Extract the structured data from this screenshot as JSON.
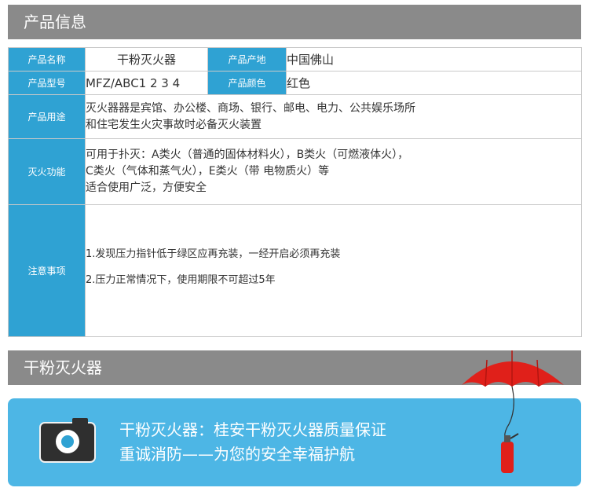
{
  "header1": {
    "title": "产品信息"
  },
  "table": {
    "row1": {
      "label1": "产品名称",
      "value1": "干粉灭火器",
      "label2": "产品产地",
      "value2": "中国佛山"
    },
    "row2": {
      "label1": "产品型号",
      "value1": "MFZ/ABC1 2 3 4",
      "label2": "产品颜色",
      "value2": "红色"
    },
    "usage": {
      "label": "产品用途",
      "lines": [
        "灭火器器是宾馆、办公楼、商场、银行、邮电、电力、公共娱乐场所",
        "和住宅发生火灾事故时必备灭火装置"
      ]
    },
    "function": {
      "label": "灭火功能",
      "lines": [
        "可用于扑灭：A类火（普通的固体材料火），B类火（可燃液体火），",
        "C类火（气体和蒸气火），E类火（带 电物质火）等",
        "适合使用广泛，方便安全"
      ]
    },
    "notes": {
      "label": "注意事项",
      "lines": [
        "1.发现压力指针低于绿区应再充装，一经开启必须再充装",
        "2.压力正常情况下，使用期限不可超过5年"
      ]
    }
  },
  "header2": {
    "title": "干粉灭火器"
  },
  "banner": {
    "line1": "干粉灭火器：桂安干粉灭火器质量保证",
    "line2": "重诚消防——为您的安全幸福护航"
  },
  "colors": {
    "accent": "#2fa2d3",
    "header_gray": "#8a8a8a",
    "banner_blue": "#4db6e5",
    "umbrella_red": "#e0201a"
  }
}
